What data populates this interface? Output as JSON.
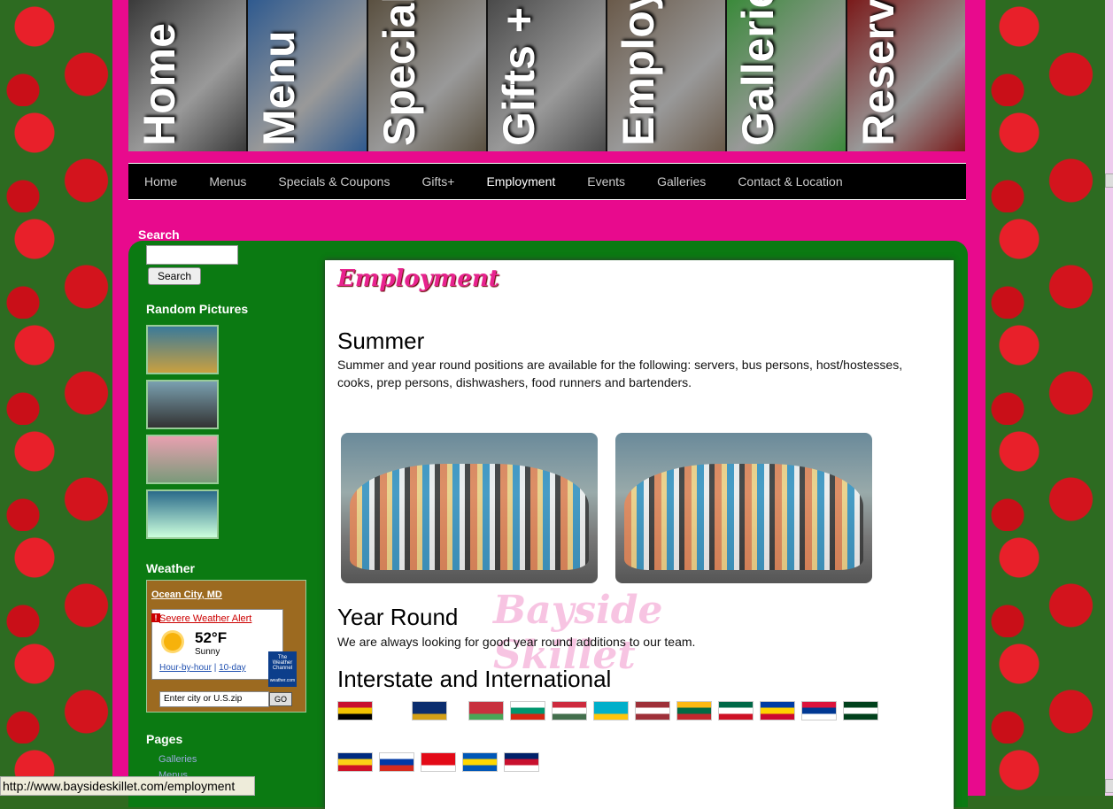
{
  "banner": {
    "tiles": [
      {
        "label": "Home",
        "color": "#3a3a3a"
      },
      {
        "label": "Menu",
        "color": "#2f5a8f"
      },
      {
        "label": "Specials",
        "color": "#5a5040"
      },
      {
        "label": "Gifts +",
        "color": "#4a4a4a"
      },
      {
        "label": "Employment",
        "color": "#6a5a4a"
      },
      {
        "label": "Galleries",
        "color": "#3a8a3a"
      },
      {
        "label": "Reservations",
        "color": "#7a1a1a"
      }
    ]
  },
  "nav": {
    "items": [
      "Home",
      "Menus",
      "Specials & Coupons",
      "Gifts+",
      "Employment",
      "Events",
      "Galleries",
      "Contact & Location"
    ],
    "active": "Employment"
  },
  "sidebar": {
    "search_title": "Search",
    "search_button": "Search",
    "random_title": "Random Pictures",
    "weather_title": "Weather",
    "weather": {
      "city": "Ocean City, MD",
      "alert": "Severe Weather Alert",
      "temp": "52°F",
      "condition": "Sunny",
      "hourly": "Hour-by-hour",
      "ten_day": "10-day",
      "logo": "The Weather Channel",
      "logo_url": "weather.com",
      "input_placeholder": "Enter city or U.S.zip",
      "go": "GO"
    },
    "pages_title": "Pages",
    "pages": [
      "Galleries",
      "Menus"
    ]
  },
  "content": {
    "title": "Employment",
    "summer_heading": "Summer",
    "summer_text": "Summer and year round positions are available for the following: servers, bus persons, host/hostesses, cooks, prep persons, dishwashers, food runners and bartenders.",
    "year_heading": "Year Round",
    "year_text": "We are always looking for good year round additions to our team.",
    "intl_heading": "Interstate and International",
    "watermark": "Bayside Skillet"
  },
  "flags_row1": [
    {
      "name": "maryland-flag",
      "colors": [
        "#c8102e",
        "#f2c300",
        "#000",
        "#fff"
      ]
    },
    {
      "name": "pennsylvania-flag",
      "colors": [
        "#0b2d6e",
        "#0b2d6e",
        "#d4a017",
        "#0b2d6e"
      ]
    },
    {
      "name": "belarus-flag",
      "colors": [
        "#c8313e",
        "#c8313e",
        "#4aa657",
        "#c8313e"
      ]
    },
    {
      "name": "bulgaria-flag",
      "colors": [
        "#fff",
        "#00966e",
        "#d62612",
        "#fff"
      ]
    },
    {
      "name": "hungary-flag",
      "colors": [
        "#cd2a3e",
        "#fff",
        "#436f4d",
        "#fff"
      ]
    },
    {
      "name": "kazakhstan-flag",
      "colors": [
        "#00afca",
        "#00afca",
        "#fec50c",
        "#00afca"
      ]
    },
    {
      "name": "latvia-flag",
      "colors": [
        "#9e3039",
        "#fff",
        "#9e3039",
        "#fff"
      ]
    },
    {
      "name": "lithuania-flag",
      "colors": [
        "#fdb913",
        "#006a44",
        "#c1272d",
        "#fff"
      ]
    },
    {
      "name": "mexico-flag",
      "colors": [
        "#006847",
        "#fff",
        "#ce1126",
        "#fff"
      ]
    },
    {
      "name": "moldova-flag",
      "colors": [
        "#003da5",
        "#ffd200",
        "#cc092f",
        "#fff"
      ]
    },
    {
      "name": "nepal-flag",
      "colors": [
        "#dc143c",
        "#003893",
        "#fff",
        "#fff"
      ]
    },
    {
      "name": "pakistan-flag",
      "colors": [
        "#01411c",
        "#fff",
        "#01411c",
        "#fff"
      ]
    }
  ],
  "flags_row2": [
    {
      "name": "romania-flag",
      "colors": [
        "#002b7f",
        "#fcd116",
        "#ce1126",
        "#fff"
      ]
    },
    {
      "name": "russia-flag",
      "colors": [
        "#fff",
        "#0039a6",
        "#d52b1e",
        "#fff"
      ]
    },
    {
      "name": "turkey-flag",
      "colors": [
        "#e30a17",
        "#e30a17",
        "#fff",
        "#e30a17"
      ]
    },
    {
      "name": "ukraine-flag",
      "colors": [
        "#0057b7",
        "#ffd700",
        "#0057b7",
        "#fff"
      ]
    },
    {
      "name": "uk-flag",
      "colors": [
        "#012169",
        "#c8102e",
        "#fff",
        "#012169"
      ]
    }
  ],
  "status_bar": "http://www.baysideskillet.com/employment"
}
